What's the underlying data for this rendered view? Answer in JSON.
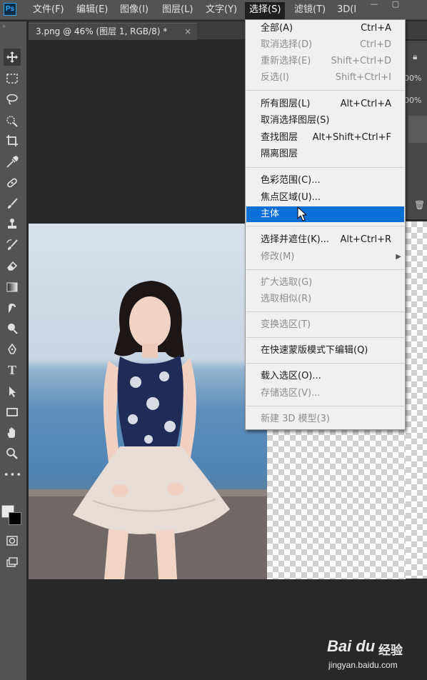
{
  "app": {
    "logo": "Ps"
  },
  "menubar": {
    "items": [
      "文件(F)",
      "编辑(E)",
      "图像(I)",
      "图层(L)",
      "文字(Y)",
      "选择(S)",
      "滤镜(T)",
      "3D(I"
    ],
    "active": "选择(S)",
    "window_controls": [
      "minimize",
      "restore"
    ]
  },
  "document_tab": {
    "title": "3.png @ 46% (图层 1, RGB/8) *",
    "close": "×"
  },
  "toolbar": {
    "tools": [
      "move-icon",
      "marquee-icon",
      "lasso-icon",
      "quick-selection-icon",
      "crop-icon",
      "eyedropper-icon",
      "healing-brush-icon",
      "brush-icon",
      "clone-stamp-icon",
      "history-brush-icon",
      "eraser-icon",
      "gradient-icon",
      "smudge-icon",
      "dodge-icon",
      "pen-icon",
      "type-icon",
      "path-selection-icon",
      "rectangle-icon",
      "hand-icon",
      "zoom-icon",
      "more-tools-icon"
    ],
    "type_glyph": "T"
  },
  "right_panel": {
    "opacity_1": "00%",
    "opacity_2": "00%"
  },
  "select_menu": {
    "groups": [
      [
        {
          "label": "全部(A)",
          "shortcut": "Ctrl+A",
          "enabled": true
        },
        {
          "label": "取消选择(D)",
          "shortcut": "Ctrl+D",
          "enabled": false
        },
        {
          "label": "重新选择(E)",
          "shortcut": "Shift+Ctrl+D",
          "enabled": false
        },
        {
          "label": "反选(I)",
          "shortcut": "Shift+Ctrl+I",
          "enabled": false
        }
      ],
      [
        {
          "label": "所有图层(L)",
          "shortcut": "Alt+Ctrl+A",
          "enabled": true
        },
        {
          "label": "取消选择图层(S)",
          "shortcut": "",
          "enabled": true
        },
        {
          "label": "查找图层",
          "shortcut": "Alt+Shift+Ctrl+F",
          "enabled": true
        },
        {
          "label": "隔离图层",
          "shortcut": "",
          "enabled": true
        }
      ],
      [
        {
          "label": "色彩范围(C)...",
          "shortcut": "",
          "enabled": true
        },
        {
          "label": "焦点区域(U)...",
          "shortcut": "",
          "enabled": true
        },
        {
          "label": "主体",
          "shortcut": "",
          "enabled": true,
          "highlighted": true
        }
      ],
      [
        {
          "label": "选择并遮住(K)...",
          "shortcut": "Alt+Ctrl+R",
          "enabled": true
        },
        {
          "label": "修改(M)",
          "shortcut": "",
          "enabled": false,
          "submenu": true
        }
      ],
      [
        {
          "label": "扩大选取(G)",
          "shortcut": "",
          "enabled": false
        },
        {
          "label": "选取相似(R)",
          "shortcut": "",
          "enabled": false
        }
      ],
      [
        {
          "label": "变换选区(T)",
          "shortcut": "",
          "enabled": false
        }
      ],
      [
        {
          "label": "在快速蒙版模式下编辑(Q)",
          "shortcut": "",
          "enabled": true
        }
      ],
      [
        {
          "label": "载入选区(O)...",
          "shortcut": "",
          "enabled": true
        },
        {
          "label": "存储选区(V)...",
          "shortcut": "",
          "enabled": false
        }
      ],
      [
        {
          "label": "新建 3D 模型(3)",
          "shortcut": "",
          "enabled": false
        }
      ]
    ]
  },
  "watermark": {
    "logo": "Bai du",
    "cn": "经验",
    "url": "jingyan.baidu.com"
  },
  "colors": {
    "menu_bg": "#535353",
    "highlight": "#0a6fd7",
    "dropdown_bg": "#f0f0f0",
    "canvas_bg": "#282828"
  }
}
